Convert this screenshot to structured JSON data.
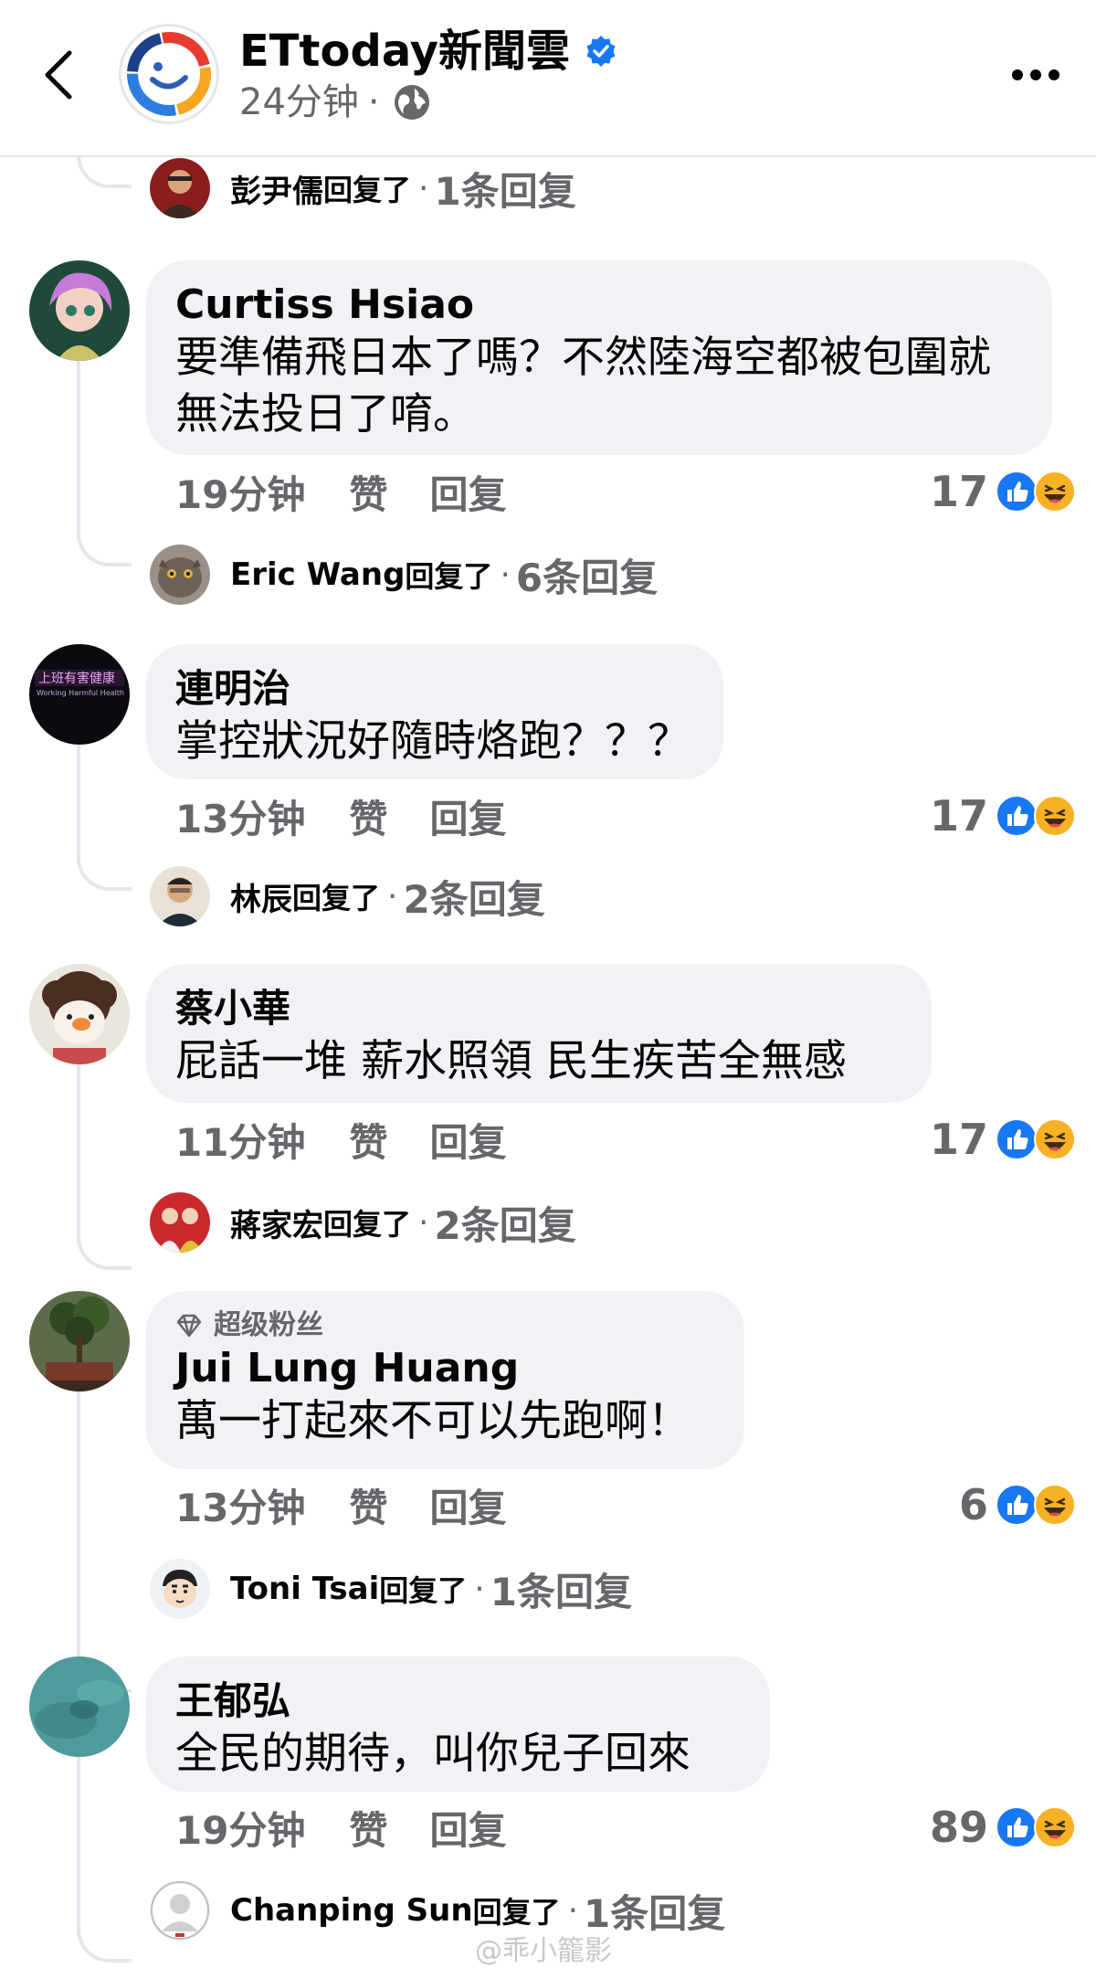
{
  "header": {
    "page_name": "ETtoday新聞雲",
    "post_time": "24分钟",
    "separator": "·"
  },
  "top_reply": {
    "name": "彭尹儒",
    "verb": "回复了",
    "count": "1条回复"
  },
  "comments": [
    {
      "author": "Curtiss Hsiao",
      "text": "要準備飛日本了嗎？不然陸海空都被包圍就無法投日了唷。",
      "time": "19分钟",
      "like": "赞",
      "reply": "回复",
      "reactions": "17",
      "reply_summary": {
        "name": "Eric Wang",
        "verb": "回复了",
        "count": "6条回复"
      }
    },
    {
      "author": "連明治",
      "text": "掌控狀況好隨時烙跑？？？",
      "time": "13分钟",
      "like": "赞",
      "reply": "回复",
      "reactions": "17",
      "reply_summary": {
        "name": "林辰",
        "verb": "回复了",
        "count": "2条回复"
      }
    },
    {
      "author": "蔡小華",
      "text": "屁話一堆 薪水照領 民生疾苦全無感",
      "time": "11分钟",
      "like": "赞",
      "reply": "回复",
      "reactions": "17",
      "reply_summary": {
        "name": "蔣家宏",
        "verb": "回复了",
        "count": "2条回复"
      }
    },
    {
      "badge": "超级粉丝",
      "author": "Jui Lung Huang",
      "text": "萬一打起來不可以先跑啊！",
      "time": "13分钟",
      "like": "赞",
      "reply": "回复",
      "reactions": "6",
      "reply_summary": {
        "name": "Toni Tsai",
        "verb": "回复了",
        "count": "1条回复"
      }
    },
    {
      "author": "王郁弘",
      "text": "全民的期待，叫你兒子回來",
      "time": "19分钟",
      "like": "赞",
      "reply": "回复",
      "reactions": "89",
      "reply_summary": {
        "name": "Chanping Sun",
        "verb": "回复了",
        "count": "1条回复"
      }
    }
  ],
  "watermark": "@乖小籠影",
  "colors": {
    "secondary_text": "#65676b",
    "bubble": "#f0f2f5",
    "like_blue": "#1877f2",
    "haha_yellow": "#f7b125"
  }
}
